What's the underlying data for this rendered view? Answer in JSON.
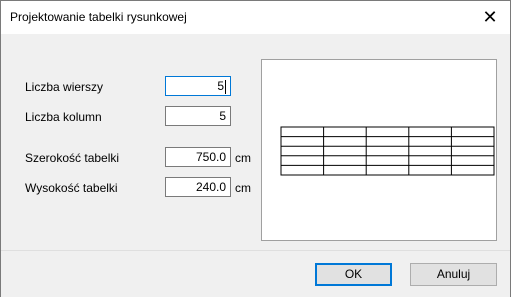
{
  "dialog": {
    "title": "Projektowanie tabelki rysunkowej",
    "close_glyph": "✕"
  },
  "fields": {
    "rows": {
      "label": "Liczba wierszy",
      "value": "5"
    },
    "cols": {
      "label": "Liczba kolumn",
      "value": "5"
    },
    "width": {
      "label": "Szerokość tabelki",
      "value": "750.0",
      "unit": "cm"
    },
    "height": {
      "label": "Wysokość tabelki",
      "value": "240.0",
      "unit": "cm"
    }
  },
  "preview": {
    "rows": 5,
    "cols": 5,
    "line_color": "#000000"
  },
  "buttons": {
    "ok": "OK",
    "cancel": "Anuluj"
  },
  "colors": {
    "accent": "#0078d7",
    "dialog_bg": "#f0f0f0"
  }
}
